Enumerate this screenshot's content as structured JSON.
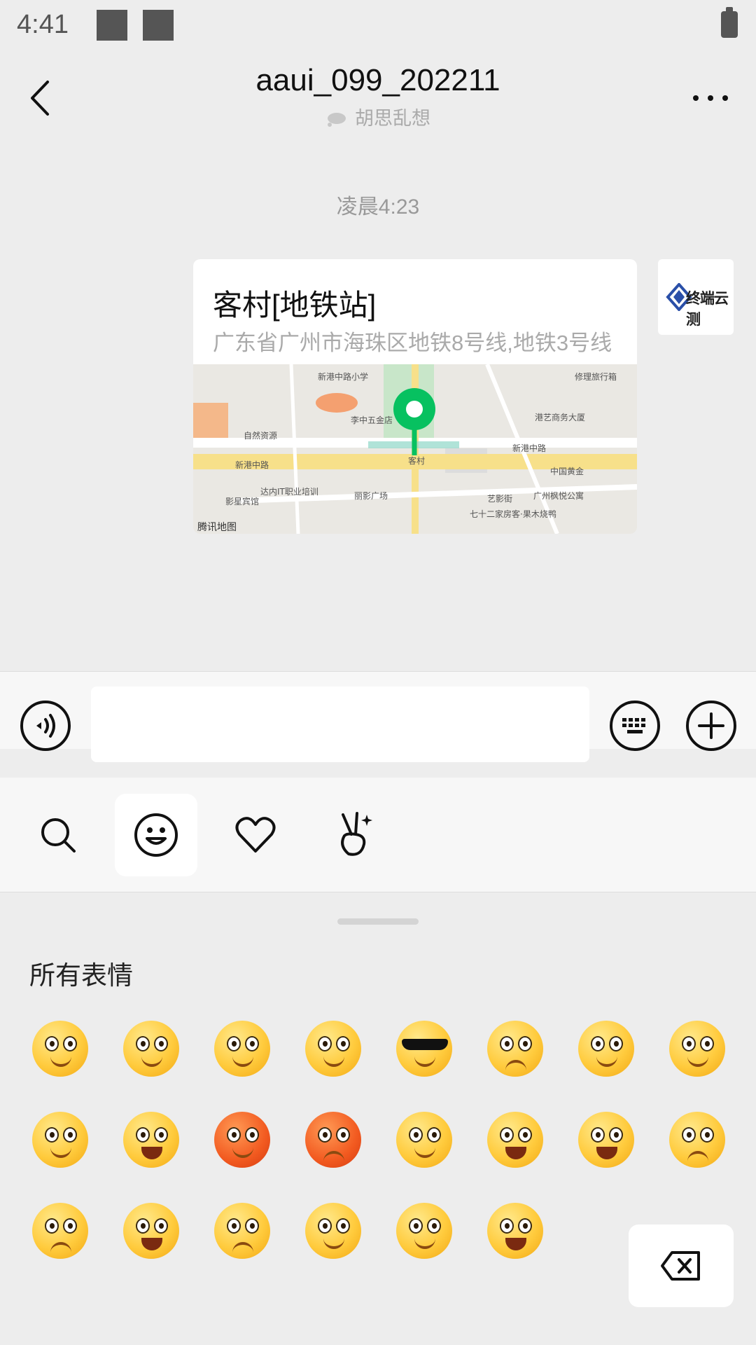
{
  "status_bar": {
    "time": "4:41"
  },
  "header": {
    "title": "aaui_099_202211",
    "subtitle": "胡思乱想"
  },
  "messages": {
    "timestamp": "凌晨4:23",
    "location": {
      "name": "客村[地铁站]",
      "address": "广东省广州市海珠区地铁8号线,地铁3号线",
      "map_labels": {
        "school": "新港中路小学",
        "hotel_top": "修理旅行箱",
        "garden": "李中五金店",
        "art": "港艺商务大厦",
        "road1": "新港中路",
        "road2": "新港中路",
        "station": "客村",
        "bank": "中国黄金",
        "photo": "丽影广场",
        "school2": "达内IT职业培训",
        "guesthouse": "影星宾馆",
        "gallery": "艺影街",
        "apartment": "广州枫悦公寓",
        "fruit": "七十二家房客·果木烧鸭",
        "resource": "自然资源",
        "brand": "腾讯地图"
      }
    },
    "avatar_text": "终端云测"
  },
  "input": {
    "placeholder": "",
    "value": ""
  },
  "emoji_tabs": [
    "search",
    "emoji",
    "favorites",
    "stickers"
  ],
  "panel": {
    "title": "所有表情",
    "emojis": [
      "smile",
      "blush-worried",
      "heart-eyes",
      "dizzy",
      "sunglasses",
      "cry",
      "shy",
      "silent",
      "sleepy",
      "grin-cry",
      "red-sweat",
      "angry",
      "tongue",
      "big-grin",
      "surprised",
      "sad",
      "embarrassed",
      "laugh-cry",
      "sick",
      "facepalm",
      "happy",
      "shocked"
    ]
  },
  "colors": {
    "accent": "#07c160",
    "background": "#ededed"
  }
}
